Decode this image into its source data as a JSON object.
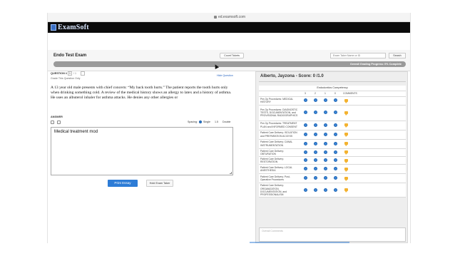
{
  "browser": {
    "url": "ed.examsoft.com"
  },
  "brand": {
    "logo_text": "ExamSoft"
  },
  "header": {
    "exam_title": "Endo Test Exam",
    "count_tickets_label": "Count Tickets",
    "search_placeholder": "Exam Taker Name or ID",
    "search_label": "Search",
    "progress_text": "Overall Grading Progress: 0% Complete",
    "progress_fraction": 0.0
  },
  "question": {
    "label": "QUESTION #",
    "number": "1",
    "of_text": "/ 1",
    "grade_text": "Grade This Question Only",
    "hide_label": "Hide Question",
    "text": "A 13 year old male presents with chief concern: “My back tooth hurts.” The patient reports the tooth hurts only when drinking something cold. A review of the medical history shows an allergy to latex and a history of asthma. He uses an albuterol inhaler for asthma attacks. He denies any other allergies or"
  },
  "answer": {
    "label": "ANSWER",
    "spacing_label": "Spacing:",
    "spacing_options": [
      "Single",
      "1.5",
      "Double"
    ],
    "text": "Medical treatment mod",
    "print_label": "Print Essay",
    "hold_label": "Hold Exam Taker"
  },
  "grading": {
    "student": "Alberto, Jayzona",
    "score_text": "- Score: 0 /1.0",
    "competency_title": "Endodontics Competency",
    "columns": [
      "3",
      "2",
      "1",
      "0",
      "COMMENTS"
    ],
    "rows": [
      "Pre-Op Procedures: MEDICAL HISTORY",
      "Pre-Op Procedures: DIAGNOSTIC TESTS, DOCUMENTATION, and PROVISIONAL RADIOGRAPHICS",
      "Pre-Op Procedures: TREATMENT PLAN and INFORMED CONSENT",
      "Patient Care Delivery: ISOLATION and PREPARATION ACCESS",
      "Patient Care Delivery: CANAL INSTRUMENTATION",
      "Patient Care Delivery: OBTURATION",
      "Patient Care Delivery: RESTORATION",
      "Patient Care Delivery: LOCAL ANESTHESIA",
      "Patient Care Delivery: Post-Operative Procedures",
      "Patient Care Delivery: ORGANIZATION, DOCUMENTATION, and PROFESSIONALISM"
    ],
    "overall_placeholder": "Overall Comments"
  },
  "colors": {
    "accent": "#2d7cd6",
    "brand_bar": "#0b0b0b",
    "note": "#f3b22f"
  }
}
